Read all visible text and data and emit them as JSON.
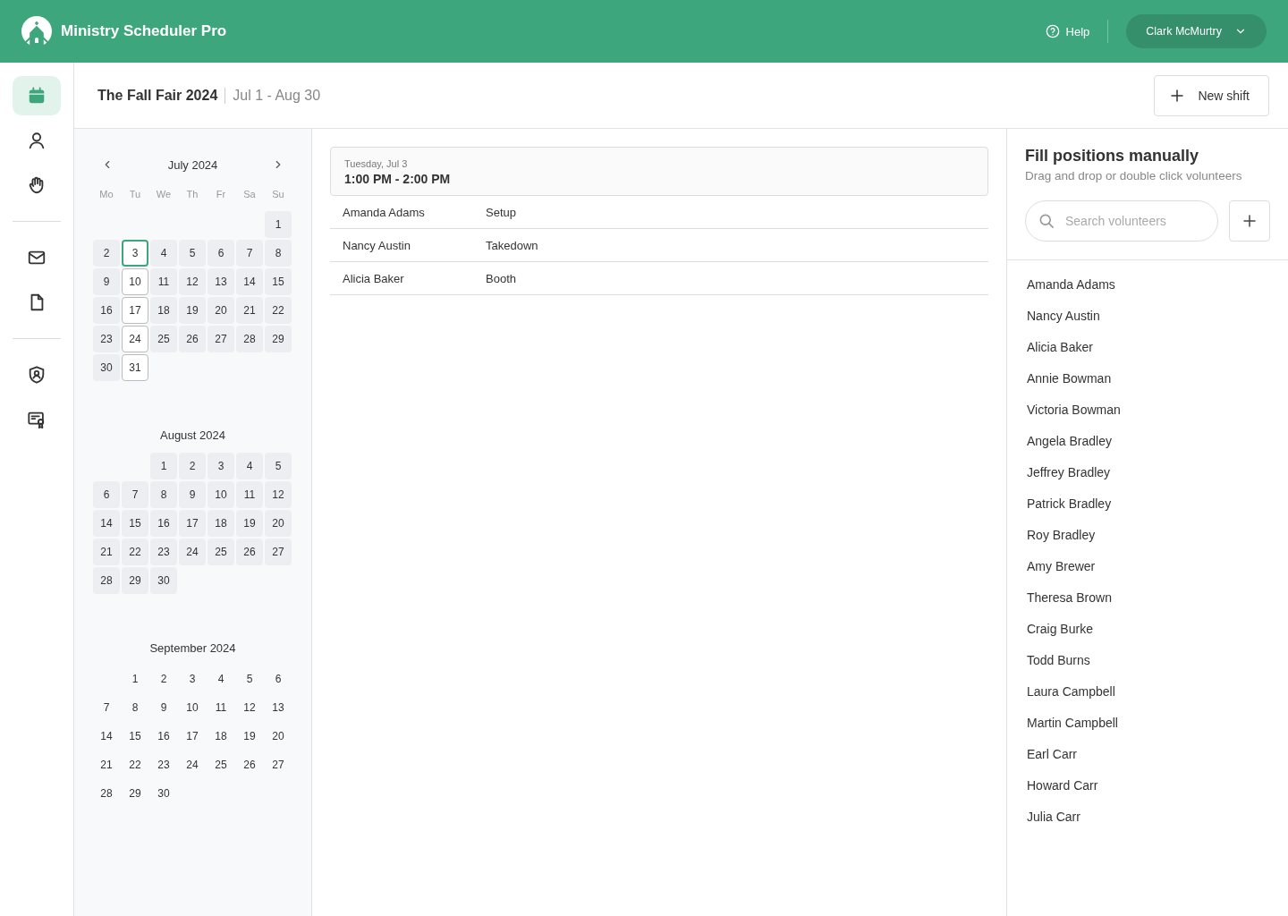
{
  "app": {
    "title": "Ministry Scheduler Pro",
    "help": "Help",
    "user": "Clark McMurtry"
  },
  "sidebar": {
    "groups": [
      [
        {
          "selected": true
        },
        {
          "selected": false
        },
        {
          "selected": false
        }
      ],
      [
        {
          "selected": false
        },
        {
          "selected": false
        }
      ],
      [
        {
          "selected": false
        },
        {
          "selected": false
        }
      ]
    ]
  },
  "event": {
    "title": "The Fall Fair 2024",
    "range": "Jul 1 - Aug 30",
    "new_button": "New shift"
  },
  "calendar": {
    "weekdays": [
      "Mo",
      "Tu",
      "We",
      "Th",
      "Fr",
      "Sa",
      "Su"
    ],
    "months": [
      {
        "title": "July 2024",
        "weeks": [
          [
            {
              "kind": "blank"
            },
            {
              "kind": "blank"
            },
            {
              "kind": "blank"
            },
            {
              "kind": "blank"
            },
            {
              "kind": "blank"
            },
            {
              "kind": "blank"
            },
            {
              "d": "1",
              "kind": "filled",
              "selected": false
            }
          ],
          [
            {
              "d": "2",
              "kind": "filled",
              "selected": false
            },
            {
              "d": "3",
              "kind": "filled",
              "selected": true
            },
            {
              "d": "4",
              "kind": "filled",
              "selected": false
            },
            {
              "d": "5",
              "kind": "filled",
              "selected": false
            },
            {
              "d": "6",
              "kind": "filled",
              "selected": false
            },
            {
              "d": "7",
              "kind": "filled",
              "selected": false
            },
            {
              "d": "8",
              "kind": "filled",
              "selected": false
            }
          ],
          [
            {
              "d": "9",
              "kind": "filled",
              "selected": false
            },
            {
              "d": "10",
              "kind": "outlined",
              "selected": false
            },
            {
              "d": "11",
              "kind": "filled",
              "selected": false
            },
            {
              "d": "12",
              "kind": "filled",
              "selected": false
            },
            {
              "d": "13",
              "kind": "filled",
              "selected": false
            },
            {
              "d": "14",
              "kind": "filled",
              "selected": false
            },
            {
              "d": "15",
              "kind": "filled",
              "selected": false
            }
          ],
          [
            {
              "d": "16",
              "kind": "filled",
              "selected": false
            },
            {
              "d": "17",
              "kind": "outlined",
              "selected": false
            },
            {
              "d": "18",
              "kind": "filled",
              "selected": false
            },
            {
              "d": "19",
              "kind": "filled",
              "selected": false
            },
            {
              "d": "20",
              "kind": "filled",
              "selected": false
            },
            {
              "d": "21",
              "kind": "filled",
              "selected": false
            },
            {
              "d": "22",
              "kind": "filled",
              "selected": false
            }
          ],
          [
            {
              "d": "23",
              "kind": "filled",
              "selected": false
            },
            {
              "d": "24",
              "kind": "outlined",
              "selected": false
            },
            {
              "d": "25",
              "kind": "filled",
              "selected": false
            },
            {
              "d": "26",
              "kind": "filled",
              "selected": false
            },
            {
              "d": "27",
              "kind": "filled",
              "selected": false
            },
            {
              "d": "28",
              "kind": "filled",
              "selected": false
            },
            {
              "d": "29",
              "kind": "filled",
              "selected": false
            }
          ],
          [
            {
              "d": "30",
              "kind": "filled",
              "selected": false
            },
            {
              "d": "31",
              "kind": "outlined",
              "selected": false
            }
          ]
        ]
      },
      {
        "title": "August 2024",
        "weeks": [
          [
            {
              "kind": "blank"
            },
            {
              "kind": "blank"
            },
            {
              "d": "1",
              "kind": "filled",
              "selected": false
            },
            {
              "d": "2",
              "kind": "filled",
              "selected": false
            },
            {
              "d": "3",
              "kind": "filled",
              "selected": false
            },
            {
              "d": "4",
              "kind": "filled",
              "selected": false
            },
            {
              "d": "5",
              "kind": "filled",
              "selected": false
            }
          ],
          [
            {
              "d": "6",
              "kind": "filled",
              "selected": false
            },
            {
              "d": "7",
              "kind": "filled",
              "selected": false
            },
            {
              "d": "8",
              "kind": "filled",
              "selected": false
            },
            {
              "d": "9",
              "kind": "filled",
              "selected": false
            },
            {
              "d": "10",
              "kind": "filled",
              "selected": false
            },
            {
              "d": "11",
              "kind": "filled",
              "selected": false
            },
            {
              "d": "12",
              "kind": "filled",
              "selected": false
            }
          ],
          [
            {
              "d": "14",
              "kind": "filled",
              "selected": false
            },
            {
              "d": "15",
              "kind": "filled",
              "selected": false
            },
            {
              "d": "16",
              "kind": "filled",
              "selected": false
            },
            {
              "d": "17",
              "kind": "filled",
              "selected": false
            },
            {
              "d": "18",
              "kind": "filled",
              "selected": false
            },
            {
              "d": "19",
              "kind": "filled",
              "selected": false
            },
            {
              "d": "20",
              "kind": "filled",
              "selected": false
            }
          ],
          [
            {
              "d": "21",
              "kind": "filled",
              "selected": false
            },
            {
              "d": "22",
              "kind": "filled",
              "selected": false
            },
            {
              "d": "23",
              "kind": "filled",
              "selected": false
            },
            {
              "d": "24",
              "kind": "filled",
              "selected": false
            },
            {
              "d": "25",
              "kind": "filled",
              "selected": false
            },
            {
              "d": "26",
              "kind": "filled",
              "selected": false
            },
            {
              "d": "27",
              "kind": "filled",
              "selected": false
            }
          ],
          [
            {
              "d": "28",
              "kind": "filled",
              "selected": false
            },
            {
              "d": "29",
              "kind": "filled",
              "selected": false
            },
            {
              "d": "30",
              "kind": "filled",
              "selected": false
            }
          ]
        ]
      },
      {
        "title": "September 2024",
        "weeks": [
          [
            {
              "kind": "blank"
            },
            {
              "d": "1",
              "kind": "plain",
              "selected": false
            },
            {
              "d": "2",
              "kind": "plain",
              "selected": false
            },
            {
              "d": "3",
              "kind": "plain",
              "selected": false
            },
            {
              "d": "4",
              "kind": "plain",
              "selected": false
            },
            {
              "d": "5",
              "kind": "plain",
              "selected": false
            },
            {
              "d": "6",
              "kind": "plain",
              "selected": false
            }
          ],
          [
            {
              "d": "7",
              "kind": "plain",
              "selected": false
            },
            {
              "d": "8",
              "kind": "plain",
              "selected": false
            },
            {
              "d": "9",
              "kind": "plain",
              "selected": false
            },
            {
              "d": "10",
              "kind": "plain",
              "selected": false
            },
            {
              "d": "11",
              "kind": "plain",
              "selected": false
            },
            {
              "d": "12",
              "kind": "plain",
              "selected": false
            },
            {
              "d": "13",
              "kind": "plain",
              "selected": false
            }
          ],
          [
            {
              "d": "14",
              "kind": "plain",
              "selected": false
            },
            {
              "d": "15",
              "kind": "plain",
              "selected": false
            },
            {
              "d": "16",
              "kind": "plain",
              "selected": false
            },
            {
              "d": "17",
              "kind": "plain",
              "selected": false
            },
            {
              "d": "18",
              "kind": "plain",
              "selected": false
            },
            {
              "d": "19",
              "kind": "plain",
              "selected": false
            },
            {
              "d": "20",
              "kind": "plain",
              "selected": false
            }
          ],
          [
            {
              "d": "21",
              "kind": "plain",
              "selected": false
            },
            {
              "d": "22",
              "kind": "plain",
              "selected": false
            },
            {
              "d": "23",
              "kind": "plain",
              "selected": false
            },
            {
              "d": "24",
              "kind": "plain",
              "selected": false
            },
            {
              "d": "25",
              "kind": "plain",
              "selected": false
            },
            {
              "d": "26",
              "kind": "plain",
              "selected": false
            },
            {
              "d": "27",
              "kind": "plain",
              "selected": false
            }
          ],
          [
            {
              "d": "28",
              "kind": "plain",
              "selected": false
            },
            {
              "d": "29",
              "kind": "plain",
              "selected": false
            },
            {
              "d": "30",
              "kind": "plain",
              "selected": false
            }
          ]
        ]
      }
    ]
  },
  "shift": {
    "date": "Tuesday, Jul 3",
    "time": "1:00 PM - 2:00 PM",
    "rows": [
      {
        "name": "Amanda Adams",
        "position": "Setup"
      },
      {
        "name": "Nancy Austin",
        "position": "Takedown"
      },
      {
        "name": "Alicia Baker",
        "position": "Booth"
      }
    ]
  },
  "volunteers": {
    "title": "Fill positions manually",
    "subtitle": "Drag and drop or double click volunteers",
    "search": {
      "placeholder": "Search volunteers"
    },
    "items": [
      "Amanda Adams",
      "Nancy Austin",
      "Alicia Baker",
      "Annie Bowman",
      "Victoria Bowman",
      "Angela Bradley",
      "Jeffrey Bradley",
      "Patrick Bradley",
      "Roy Bradley",
      "Amy Brewer",
      "Theresa Brown",
      "Craig Burke",
      "Todd Burns",
      "Laura Campbell",
      "Martin Campbell",
      "Earl Carr",
      "Howard Carr",
      "Julia Carr"
    ]
  }
}
